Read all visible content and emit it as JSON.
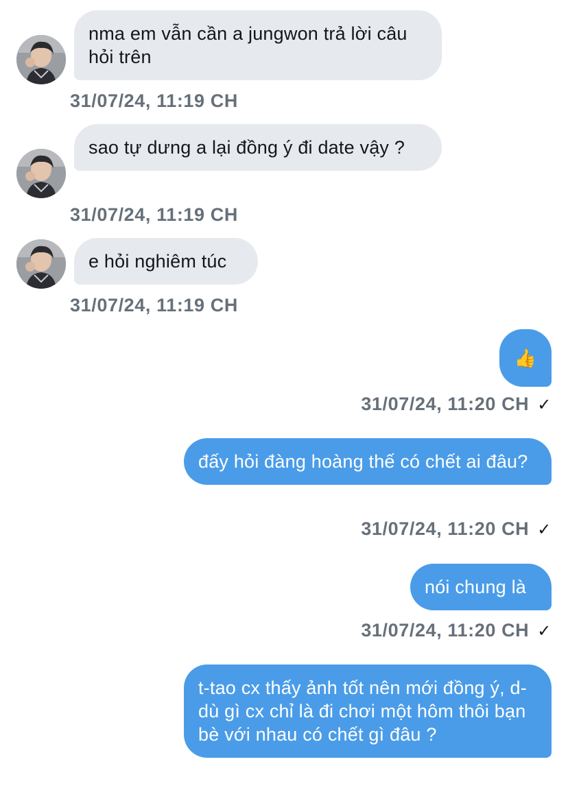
{
  "messages": [
    {
      "direction": "incoming",
      "text": "nma em vẫn cần a jungwon trả lời câu hỏi trên",
      "timestamp": "31/07/24, 11:19 CH"
    },
    {
      "direction": "incoming",
      "text": "sao tự dưng a lại đồng ý đi date vậy ?",
      "timestamp": "31/07/24, 11:19 CH"
    },
    {
      "direction": "incoming",
      "text": "e hỏi nghiêm túc",
      "timestamp": "31/07/24, 11:19 CH"
    },
    {
      "direction": "outgoing",
      "text": "👍",
      "timestamp": "31/07/24, 11:20 CH",
      "status": "✓"
    },
    {
      "direction": "outgoing",
      "text": "đấy hỏi đàng hoàng thế có chết ai đâu?",
      "timestamp": "31/07/24, 11:20 CH",
      "status": "✓"
    },
    {
      "direction": "outgoing",
      "text": "nói chung là",
      "timestamp": "31/07/24, 11:20 CH",
      "status": "✓"
    },
    {
      "direction": "outgoing",
      "text": "t-tao cx thấy ảnh tốt nên mới đồng ý, d-dù gì cx chỉ là đi chơi một hôm thôi bạn bè với nhau có chết gì đâu ?",
      "timestamp": "",
      "status": ""
    }
  ],
  "colors": {
    "incoming_bubble": "#e6e9ed",
    "outgoing_bubble": "#4a9ce8",
    "timestamp_text": "#66707a"
  },
  "icons": {
    "avatar": "user-avatar-photo",
    "read_receipt": "checkmark-icon",
    "reaction": "thumbs-up-emoji"
  }
}
